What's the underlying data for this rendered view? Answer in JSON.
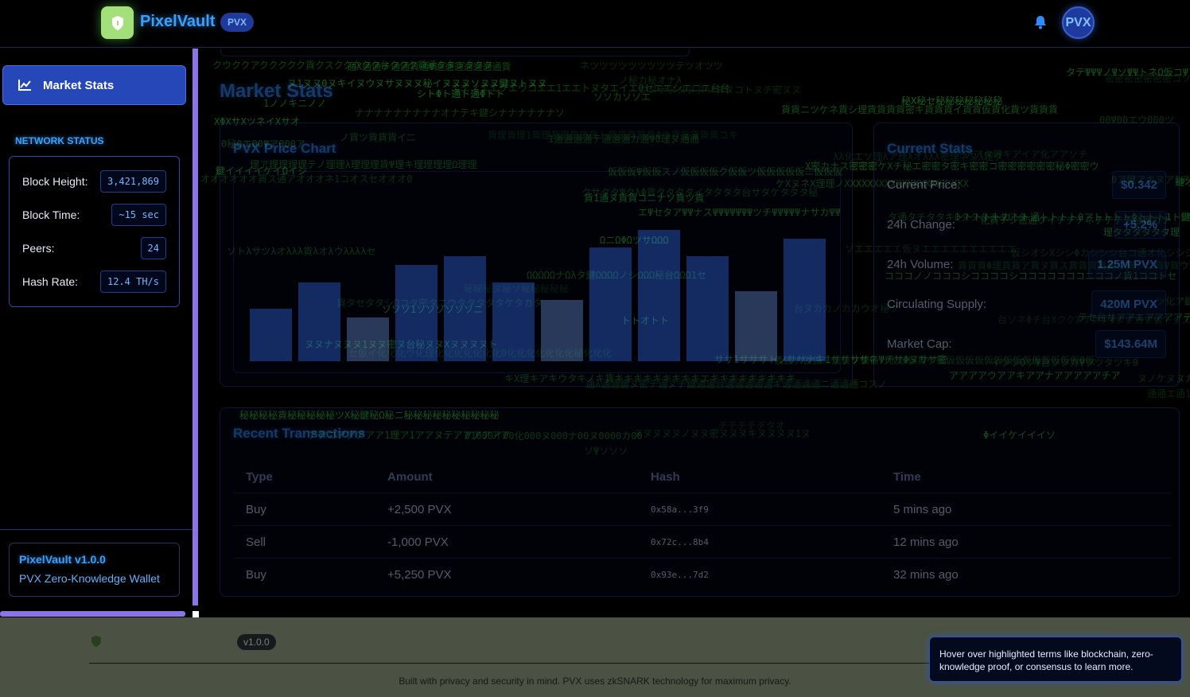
{
  "header": {
    "brand": "PixelVault",
    "badge": "PVX",
    "avatar": "PVX"
  },
  "sidebar": {
    "active_item": "Market Stats",
    "network_title": "NETWORK STATUS",
    "network": [
      {
        "label": "Block Height:",
        "value": "3,421,869"
      },
      {
        "label": "Block Time:",
        "value": "~15 sec"
      },
      {
        "label": "Peers:",
        "value": "24"
      },
      {
        "label": "Hash Rate:",
        "value": "12.4 TH/s"
      }
    ],
    "version_title": "PixelVault v1.0.0",
    "version_sub": "PVX Zero-Knowledge Wallet"
  },
  "main": {
    "page_title": "Market Stats",
    "chart_title": "PVX Price Chart",
    "stats_title": "Current Stats",
    "stats": [
      {
        "label": "Current Price:",
        "value": "$0.342"
      },
      {
        "label": "24h Change:",
        "value": "+5.2%"
      },
      {
        "label": "24h Volume:",
        "value": "1.25M PVX"
      },
      {
        "label": "Circulating Supply:",
        "value": "420M PVX"
      },
      {
        "label": "Market Cap:",
        "value": "$143.64M"
      }
    ],
    "tx_title": "Recent Transactions",
    "tx_headers": [
      "Type",
      "Amount",
      "Hash",
      "Time"
    ],
    "tx_rows": [
      [
        "Buy",
        "+2,500 PVX",
        "0x58a...3f9",
        "5 mins ago"
      ],
      [
        "Sell",
        "-1,000 PVX",
        "0x72c...8b4",
        "12 mins ago"
      ],
      [
        "Buy",
        "+5,250 PVX",
        "0x93e...7d2",
        "32 mins ago"
      ]
    ]
  },
  "chart_data": {
    "type": "bar",
    "values": [
      30,
      45,
      25,
      55,
      60,
      45,
      35,
      65,
      75,
      60,
      40,
      70
    ],
    "ylim": [
      0,
      100
    ],
    "highlight_indices": [
      2,
      6,
      10
    ],
    "colors": {
      "bar": "#2d5fd8",
      "bar_light": "#5a7fc8"
    }
  },
  "footer": {
    "badge": "v1.0.0",
    "text": "Built with privacy and security in mind. PVX uses zkSNARK technology for maximum privacy."
  },
  "tooltip": {
    "text": "Hover over highlighted terms like blockchain, zero-knowledge proof, or consensus to learn more."
  },
  "colors": {
    "accent": "#3aa0ff",
    "sidebar_edge": "#8a74e6",
    "logo": "#a3e07a"
  }
}
